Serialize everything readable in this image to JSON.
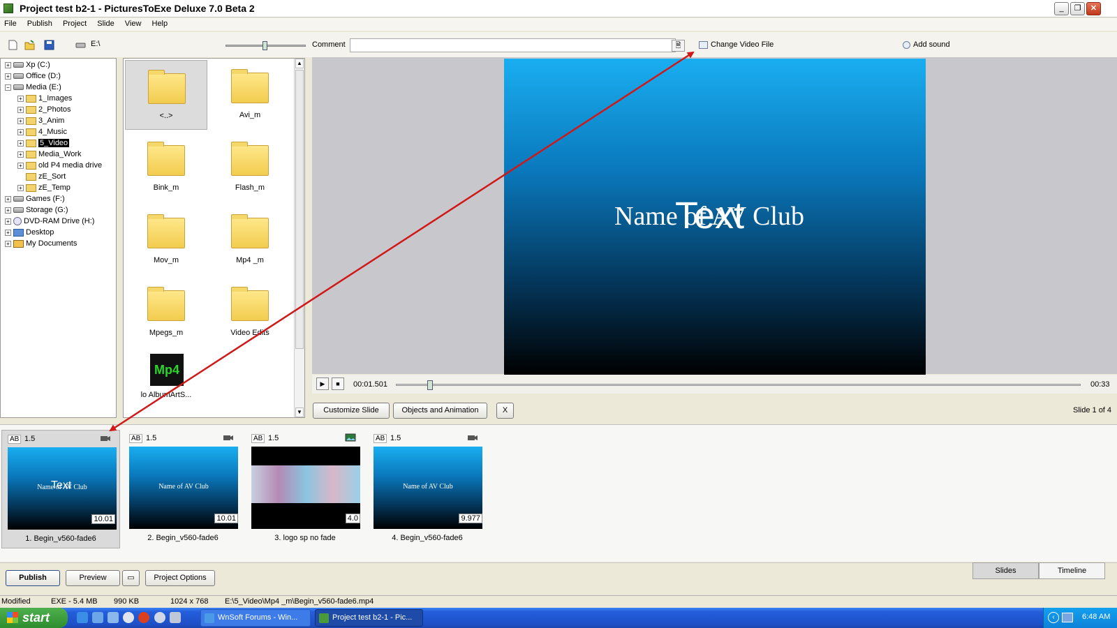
{
  "window": {
    "title": "Project test b2-1 - PicturesToExe Deluxe 7.0 Beta 2",
    "min": "_",
    "max": "❐",
    "close": "✕"
  },
  "menu": [
    "File",
    "Publish",
    "Project",
    "Slide",
    "View",
    "Help"
  ],
  "toolbar": {
    "drive_path": "E:\\",
    "comment_label": "Comment",
    "comment_value": "",
    "change_video": "Change Video File",
    "add_sound": "Add sound"
  },
  "tree": [
    {
      "label": "Xp (C:)",
      "icon": "drive-icon",
      "sign": "+"
    },
    {
      "label": "Office (D:)",
      "icon": "drive-icon",
      "sign": "+"
    },
    {
      "label": "Media (E:)",
      "icon": "drive-icon",
      "sign": "−"
    },
    {
      "label": "1_Images",
      "icon": "folder-icon",
      "sign": "+"
    },
    {
      "label": "2_Photos",
      "icon": "folder-icon",
      "sign": "+"
    },
    {
      "label": "3_Anim",
      "icon": "folder-icon",
      "sign": "+"
    },
    {
      "label": "4_Music",
      "icon": "folder-icon",
      "sign": "+"
    },
    {
      "label": "5_Video",
      "icon": "folder-icon",
      "sign": "+",
      "selected": true
    },
    {
      "label": "Media_Work",
      "icon": "folder-icon",
      "sign": "+"
    },
    {
      "label": "old P4 media drive",
      "icon": "folder-icon",
      "sign": "+"
    },
    {
      "label": "zE_Sort",
      "icon": "folder-icon",
      "sign": ""
    },
    {
      "label": "zE_Temp",
      "icon": "folder-icon",
      "sign": "+"
    },
    {
      "label": "Games (F:)",
      "icon": "drive-icon",
      "sign": "+"
    },
    {
      "label": "Storage (G:)",
      "icon": "drive-icon",
      "sign": "+"
    },
    {
      "label": "DVD-RAM Drive (H:)",
      "icon": "dvd-icon",
      "sign": "+"
    },
    {
      "label": "Desktop",
      "icon": "desktop-icon",
      "sign": "+"
    },
    {
      "label": "My Documents",
      "icon": "documents-icon",
      "sign": "+"
    }
  ],
  "files": [
    {
      "label": "<..>",
      "kind": "up"
    },
    {
      "label": "Avi_m",
      "kind": "folder"
    },
    {
      "label": "Bink_m",
      "kind": "folder"
    },
    {
      "label": "Flash_m",
      "kind": "folder"
    },
    {
      "label": "Mov_m",
      "kind": "folder"
    },
    {
      "label": "Mp4 _m",
      "kind": "folder"
    },
    {
      "label": "Mpegs_m",
      "kind": "folder"
    },
    {
      "label": "Video Edits",
      "kind": "folder"
    },
    {
      "label": "lo AlbumArtS...",
      "kind": "mp4",
      "badge": "Mp4"
    }
  ],
  "preview": {
    "text_serif": "Name of AV Club",
    "text_sans": "Text",
    "time_current": "00:01.501",
    "time_end": "00:33",
    "seek_fraction": 0.045
  },
  "slide_buttons": {
    "customize": "Customize Slide",
    "objects": "Objects and Animation",
    "close": "X",
    "count": "Slide 1 of 4"
  },
  "slides": [
    {
      "ab": "AB",
      "duration": "1.5",
      "length": "10.01",
      "label": "1. Begin_v560-fade6",
      "kind": "video",
      "text": "Name of AV Club",
      "overlay": "Text",
      "selected": true
    },
    {
      "ab": "AB",
      "duration": "1.5",
      "length": "10.01",
      "label": "2. Begin_v560-fade6",
      "kind": "video",
      "text": "Name of AV Club",
      "overlay": ""
    },
    {
      "ab": "AB",
      "duration": "1.5",
      "length": "4.0",
      "label": "3. logo sp no fade",
      "kind": "image",
      "text": "",
      "overlay": ""
    },
    {
      "ab": "AB",
      "duration": "1.5",
      "length": "9.977",
      "label": "4. Begin_v560-fade6",
      "kind": "video",
      "text": "Name of AV Club",
      "overlay": ""
    }
  ],
  "bottom": {
    "publish": "Publish",
    "preview": "Preview",
    "options": "Project Options",
    "tab_slides": "Slides",
    "tab_timeline": "Timeline"
  },
  "status": {
    "state": "Modified",
    "exe": "EXE - 5.4 MB",
    "size": "990 KB",
    "dims": "1024 x 768",
    "path": "E:\\5_Video\\Mp4 _m\\Begin_v560-fade6.mp4"
  },
  "taskbar": {
    "start": "start",
    "tasks": [
      "WnSoft Forums - Win...",
      "Project test b2-1 - Pic..."
    ],
    "clock": "6:48 AM"
  },
  "colors": {
    "arrow": "#d01818",
    "accent": "#245edb",
    "preview_top": "#19aef0"
  }
}
